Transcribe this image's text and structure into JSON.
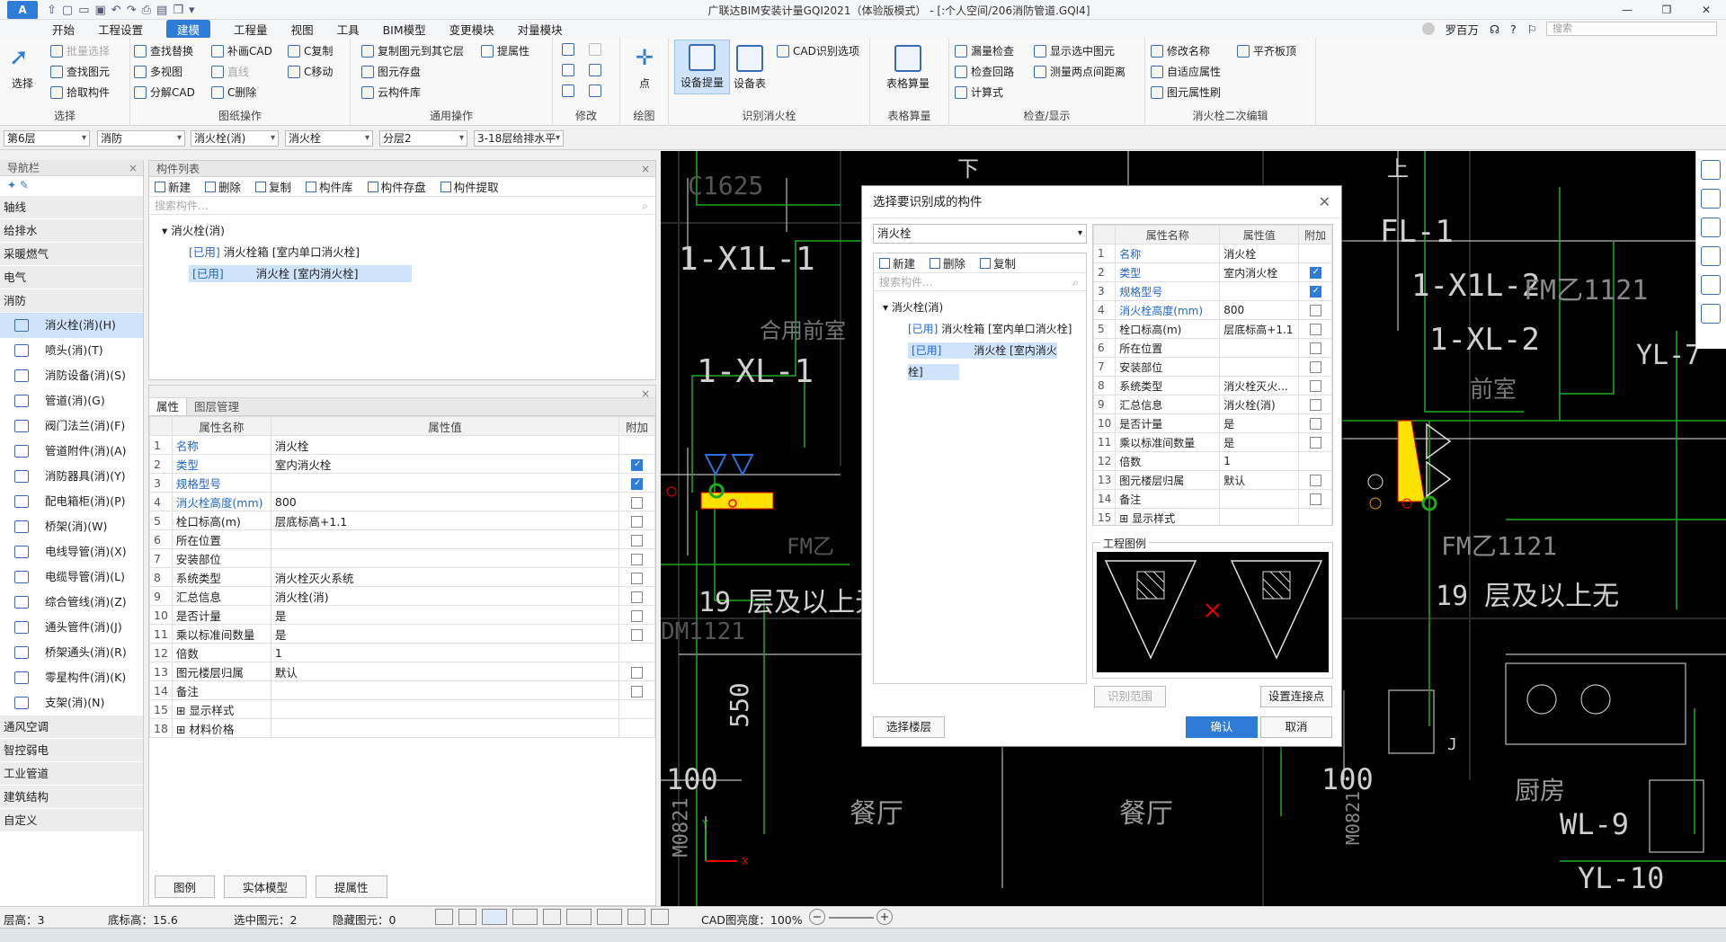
{
  "window": {
    "title": "广联达BIM安装计量GQI2021（体验版模式） - [:个人空间/206消防管道.GQI4]",
    "user": "罗百万",
    "search_placeholder": "搜索"
  },
  "menu": [
    "开始",
    "工程设置",
    "建模",
    "工程量",
    "视图",
    "工具",
    "BIM模型",
    "变更模块",
    "对量模块"
  ],
  "menu_active": "建模",
  "ribbon": {
    "select": {
      "label": "选择",
      "btn": "选择",
      "batch": "批量选择",
      "find": "查找图元",
      "pick": "拾取构件"
    },
    "drawing": {
      "label": "图纸操作",
      "find_replace": "查找替换",
      "multi": "多视图",
      "split_cad": "分解CAD",
      "fill_cad": "补画CAD",
      "line": "直线",
      "c_delete": "C删除",
      "c_copy": "C复制",
      "c_move": "C移动"
    },
    "common": {
      "label": "通用操作",
      "copy_floor": "复制图元到其它层",
      "save": "图元存盘",
      "cloud": "云构件库",
      "extract": "提属性"
    },
    "modify": {
      "label": "修改"
    },
    "draw": {
      "label": "绘图",
      "point": "点"
    },
    "identify": {
      "label": "识别消火栓",
      "device": "设备提量",
      "table": "设备表",
      "cad_opt": "CAD识别选项"
    },
    "table_calc": {
      "label": "表格算量",
      "btn": "表格算量"
    },
    "check": {
      "label": "检查/显示",
      "missing": "漏量检查",
      "show": "显示选中图元",
      "loop": "检查回路",
      "measure": "测量两点间距离",
      "formula": "计算式"
    },
    "edit2": {
      "label": "消火栓二次编辑",
      "rename": "修改名称",
      "flush": "平齐板顶",
      "adapt": "自适应属性",
      "brush": "图元属性刷"
    }
  },
  "filters": [
    "第6层",
    "消防",
    "消火栓(消)",
    "消火栓",
    "分层2",
    "3-18层给排水平"
  ],
  "nav": {
    "title": "导航栏",
    "categories_top": [
      "轴线",
      "给排水",
      "采暖燃气",
      "电气",
      "消防"
    ],
    "items": [
      "消火栓(消)(H)",
      "喷头(消)(T)",
      "消防设备(消)(S)",
      "管道(消)(G)",
      "阀门法兰(消)(F)",
      "管道附件(消)(A)",
      "消防器具(消)(Y)",
      "配电箱柜(消)(P)",
      "桥架(消)(W)",
      "电线导管(消)(X)",
      "电缆导管(消)(L)",
      "综合管线(消)(Z)",
      "通头管件(消)(J)",
      "桥架通头(消)(R)",
      "零星构件(消)(K)",
      "支架(消)(N)"
    ],
    "categories_bottom": [
      "通风空调",
      "智控弱电",
      "工业管道",
      "建筑结构",
      "自定义"
    ]
  },
  "component_list": {
    "title": "构件列表",
    "toolbar": [
      "新建",
      "删除",
      "复制",
      "构件库",
      "构件存盘",
      "构件提取"
    ],
    "search_placeholder": "搜索构件...",
    "root": "消火栓(消)",
    "children": [
      {
        "tag": "[已用]",
        "name": "消火栓箱 [室内单口消火栓]"
      },
      {
        "tag": "[已用]",
        "name": "消火栓 [室内消火栓]"
      }
    ]
  },
  "properties": {
    "tabs": [
      "属性",
      "图层管理"
    ],
    "headers": [
      "属性名称",
      "属性值",
      "附加"
    ],
    "rows": [
      {
        "n": "1",
        "name": "名称",
        "value": "消火栓",
        "blue": true,
        "cb": "none"
      },
      {
        "n": "2",
        "name": "类型",
        "value": "室内消火栓",
        "blue": true,
        "cb": "on"
      },
      {
        "n": "3",
        "name": "规格型号",
        "value": "",
        "blue": true,
        "cb": "on"
      },
      {
        "n": "4",
        "name": "消火栓高度(mm)",
        "value": "800",
        "blue": true,
        "cb": "off"
      },
      {
        "n": "5",
        "name": "栓口标高(m)",
        "value": "层底标高+1.1",
        "blue": false,
        "cb": "off"
      },
      {
        "n": "6",
        "name": "所在位置",
        "value": "",
        "blue": false,
        "cb": "off"
      },
      {
        "n": "7",
        "name": "安装部位",
        "value": "",
        "blue": false,
        "cb": "off"
      },
      {
        "n": "8",
        "name": "系统类型",
        "value": "消火栓灭火系统",
        "blue": false,
        "cb": "off"
      },
      {
        "n": "9",
        "name": "汇总信息",
        "value": "消火栓(消)",
        "blue": false,
        "cb": "off"
      },
      {
        "n": "10",
        "name": "是否计量",
        "value": "是",
        "blue": false,
        "cb": "off"
      },
      {
        "n": "11",
        "name": "乘以标准间数量",
        "value": "是",
        "blue": false,
        "cb": "off"
      },
      {
        "n": "12",
        "name": "倍数",
        "value": "1",
        "blue": false,
        "cb": "none"
      },
      {
        "n": "13",
        "name": "图元楼层归属",
        "value": "默认",
        "blue": false,
        "cb": "off"
      },
      {
        "n": "14",
        "name": "备注",
        "value": "",
        "blue": false,
        "cb": "off"
      },
      {
        "n": "15",
        "name": "⊞ 显示样式",
        "value": "",
        "blue": false,
        "cb": "none"
      },
      {
        "n": "18",
        "name": "⊞ 材料价格",
        "value": "",
        "blue": false,
        "cb": "none"
      }
    ],
    "bottom_buttons": [
      "图例",
      "实体模型",
      "提属性"
    ]
  },
  "dialog": {
    "title": "选择要识别成的构件",
    "type_select": "消火栓",
    "toolbar": [
      "新建",
      "删除",
      "复制"
    ],
    "search_placeholder": "搜索构件...",
    "root": "消火栓(消)",
    "children": [
      {
        "tag": "[已用]",
        "name": "消火栓箱 [室内单口消火栓]"
      },
      {
        "tag": "[已用]",
        "name": "消火栓 [室内消火栓]"
      }
    ],
    "headers": [
      "属性名称",
      "属性值",
      "附加"
    ],
    "rows": [
      {
        "n": "1",
        "name": "名称",
        "value": "消火栓",
        "blue": true,
        "cb": "none"
      },
      {
        "n": "2",
        "name": "类型",
        "value": "室内消火栓",
        "blue": true,
        "cb": "on"
      },
      {
        "n": "3",
        "name": "规格型号",
        "value": "",
        "blue": true,
        "cb": "on"
      },
      {
        "n": "4",
        "name": "消火栓高度(mm)",
        "value": "800",
        "blue": true,
        "cb": "off"
      },
      {
        "n": "5",
        "name": "栓口标高(m)",
        "value": "层底标高+1.1",
        "blue": false,
        "cb": "off"
      },
      {
        "n": "6",
        "name": "所在位置",
        "value": "",
        "blue": false,
        "cb": "off"
      },
      {
        "n": "7",
        "name": "安装部位",
        "value": "",
        "blue": false,
        "cb": "off"
      },
      {
        "n": "8",
        "name": "系统类型",
        "value": "消火栓灭火...",
        "blue": false,
        "cb": "off"
      },
      {
        "n": "9",
        "name": "汇总信息",
        "value": "消火栓(消)",
        "blue": false,
        "cb": "off"
      },
      {
        "n": "10",
        "name": "是否计量",
        "value": "是",
        "blue": false,
        "cb": "off"
      },
      {
        "n": "11",
        "name": "乘以标准间数量",
        "value": "是",
        "blue": false,
        "cb": "off"
      },
      {
        "n": "12",
        "name": "倍数",
        "value": "1",
        "blue": false,
        "cb": "none"
      },
      {
        "n": "13",
        "name": "图元楼层归属",
        "value": "默认",
        "blue": false,
        "cb": "off"
      },
      {
        "n": "14",
        "name": "备注",
        "value": "",
        "blue": false,
        "cb": "off"
      },
      {
        "n": "15",
        "name": "⊞ 显示样式",
        "value": "",
        "blue": false,
        "cb": "none"
      }
    ],
    "legend_title": "工程图例",
    "identify_range": "识别范围",
    "set_connect": "设置连接点",
    "select_floor": "选择楼层",
    "ok": "确认",
    "cancel": "取消"
  },
  "cad_texts": [
    "C1625",
    "1-X1L-1",
    "合用前室",
    "1-XL-1",
    "FM乙",
    "19 层及以上无",
    "DM1121",
    "550",
    "100",
    "M0821",
    "餐厅",
    "FL-1",
    "1-X1L-2",
    "FM乙1121",
    "1-XL-2",
    "前室",
    "YL-7",
    "FM乙1121",
    "19 层及以上无",
    "100",
    "餐厅",
    "M0821",
    "J",
    "厨房",
    "WL-9",
    "YL-10",
    "下",
    "上"
  ],
  "status": {
    "floor_height": "层高：3",
    "base_height": "底标高：15.6",
    "selected": "选中图元：2",
    "hidden": "隐藏图元：0",
    "brightness": "CAD图亮度：100%"
  },
  "colors": {
    "accent": "#2f7bd8",
    "cad_bg": "#000000",
    "cad_green": "#1faa1f",
    "hydrant_yellow": "#ffe100"
  }
}
